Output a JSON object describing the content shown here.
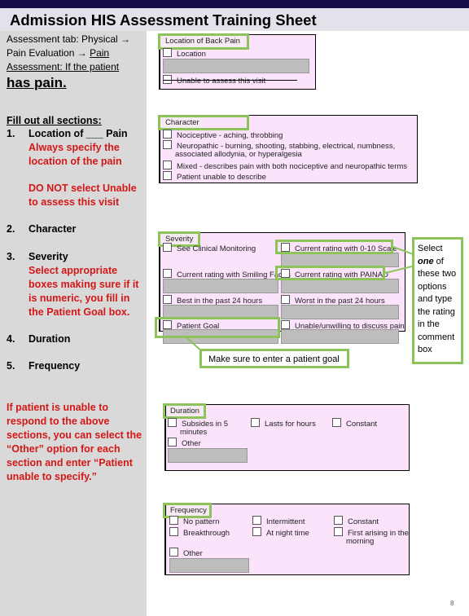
{
  "header": {
    "title": "Admission HIS Assessment Training Sheet"
  },
  "left": {
    "intro_line1": "Assessment tab: Physical →",
    "intro_line2a": "Pain Evaluation → ",
    "intro_line2b": "Pain",
    "intro_line3": "Assessment: If the patient",
    "intro_line4": "has pain.",
    "fill_heading": "Fill out all sections:",
    "steps": [
      {
        "num": "1.",
        "label": "Location of ___ Pain",
        "notes": [
          "Always specify the",
          "location of the pain",
          "",
          "DO NOT select Unable",
          "to assess this visit"
        ]
      },
      {
        "num": "2.",
        "label": "Character"
      },
      {
        "num": "3.",
        "label": "Severity",
        "notes": [
          "Select appropriate",
          "boxes making sure if it",
          "is numeric, you fill in",
          "the Patient Goal box."
        ]
      },
      {
        "num": "4.",
        "label": "Duration"
      },
      {
        "num": "5.",
        "label": "Frequency"
      }
    ],
    "unable_note": [
      "If patient is unable to",
      "respond to the above",
      "sections, you can select the",
      "“Other” option for each",
      "section and enter “Patient",
      "unable to specify.”"
    ]
  },
  "forms": {
    "location": {
      "title": "Location of  Back Pain",
      "options": [
        "Location",
        "Unable to assess this visit"
      ]
    },
    "character": {
      "title": "Character",
      "options": [
        "Nociceptive - aching, throbbing",
        "Neuropathic - burning, shooting, stabbing, electrical, numbness,",
        "associated allodynia, or hyperalgesia",
        "Mixed - describes pain with both nociceptive and neuropathic terms",
        "Patient unable to describe"
      ]
    },
    "severity": {
      "title": "Severity",
      "options": [
        "See Clinical Monitoring",
        "Current rating with 0-10 Scale",
        "Current rating with Smiling Faces",
        "Current rating with PAINAD",
        "Best in the past 24 hours",
        "Worst in the past 24 hours",
        "Patient Goal",
        "Unable/unwilling to discuss pain"
      ]
    },
    "duration": {
      "title": "Duration",
      "options": [
        "Subsides in 5",
        "minutes",
        "Lasts for hours",
        "Constant",
        "Other"
      ]
    },
    "frequency": {
      "title": "Frequency",
      "options": [
        "No pattern",
        "Intermittent",
        "Constant",
        "Breakthrough",
        "At night time",
        "First arising in the",
        "morning",
        "Other"
      ]
    }
  },
  "callouts": {
    "rating": [
      "Select",
      "one",
      " of",
      "these two",
      "options",
      "and type",
      "the rating",
      "in the",
      "comment",
      "box"
    ],
    "goal": "Make sure to enter a patient goal"
  },
  "page_number": "8",
  "colors": {
    "highlight": "#8dc45a",
    "note_red": "#d41717",
    "header_bar": "#140c48",
    "panel_bg": "#fbe3fb"
  }
}
